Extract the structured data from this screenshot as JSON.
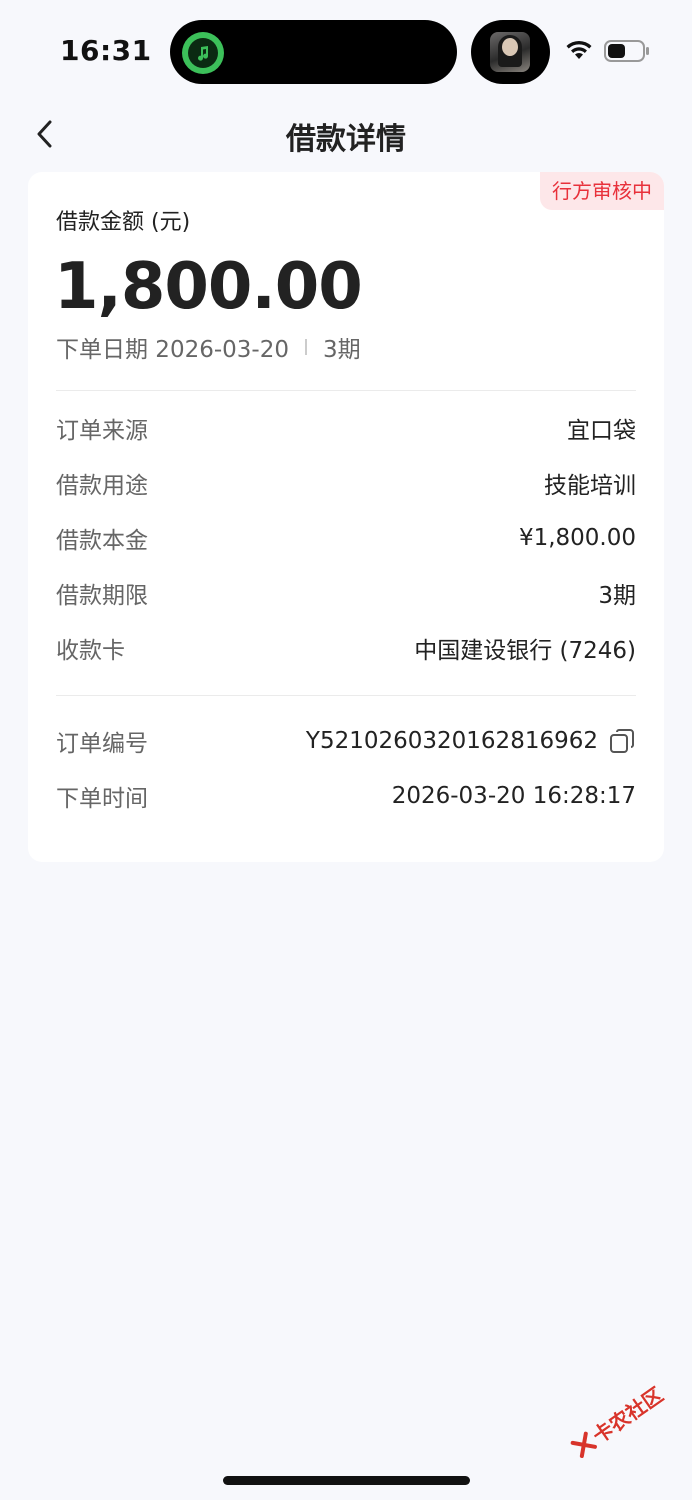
{
  "status_bar": {
    "time": "16:31"
  },
  "nav": {
    "title": "借款详情"
  },
  "loan": {
    "status_badge": "行方审核中",
    "amount_label": "借款金额 (元)",
    "amount": "1,800.00",
    "order_date": "下单日期 2026-03-20",
    "term_short": "3期"
  },
  "details": [
    {
      "label": "订单来源",
      "value": "宜口袋"
    },
    {
      "label": "借款用途",
      "value": "技能培训"
    },
    {
      "label": "借款本金",
      "value": "¥1,800.00"
    },
    {
      "label": "借款期限",
      "value": "3期"
    },
    {
      "label": "收款卡",
      "value": "中国建设银行 (7246)"
    }
  ],
  "order": {
    "number_label": "订单编号",
    "number": "Y5210260320162816962",
    "time_label": "下单时间",
    "time": "2026-03-20 16:28:17"
  },
  "watermark": {
    "text": "卡农社区"
  },
  "colors": {
    "accent_red": "#e8313b",
    "badge_bg": "#fde7e9",
    "page_bg": "#f7f8fc"
  }
}
